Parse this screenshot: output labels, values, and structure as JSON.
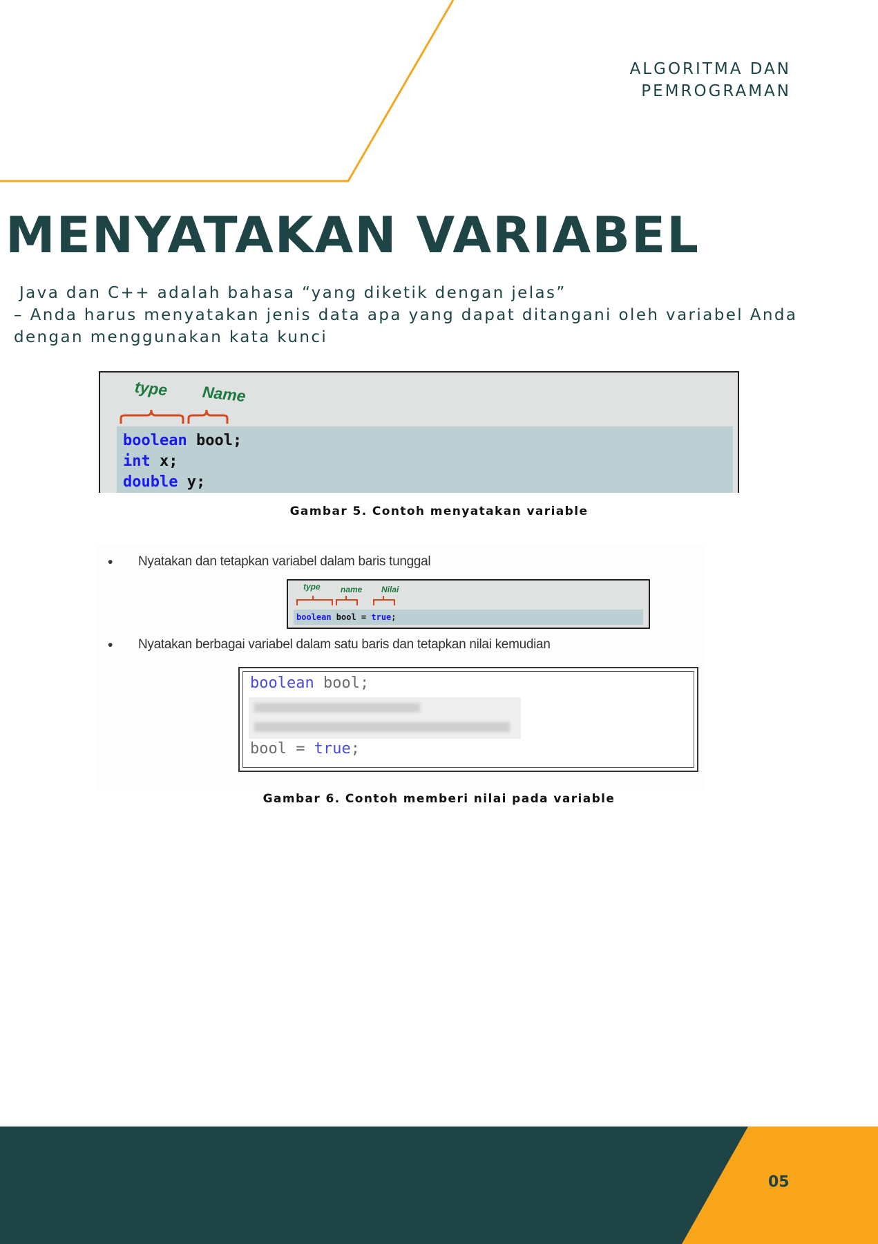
{
  "header": {
    "line1": "ALGORITMA DAN",
    "line2": "PEMROGRAMAN"
  },
  "title": "MENYATAKAN VARIABEL",
  "intro": {
    "line1": "Java dan C++ adalah bahasa “yang diketik dengan jelas”",
    "line2": "– Anda harus menyatakan jenis data apa yang dapat ditangani oleh variabel Anda",
    "line3": "dengan menggunakan kata kunci"
  },
  "figure5": {
    "annotation_type": "type",
    "annotation_name": "Name",
    "code": [
      {
        "keyword": "boolean",
        "rest": " bool;"
      },
      {
        "keyword": "int",
        "rest": " x;"
      },
      {
        "keyword": "double",
        "rest": " y;"
      }
    ],
    "caption": "Gambar 5. Contoh menyatakan variable"
  },
  "figure6": {
    "bullet_symbol": "•",
    "bullet1": "Nyatakan dan tetapkan variabel dalam baris tunggal",
    "mini_annotations": {
      "type": "type",
      "name": "name",
      "value": "Nilai"
    },
    "mini_code": {
      "keyword": "boolean",
      "middle": " bool = ",
      "value": "true",
      "end": ";"
    },
    "bullet2": "Nyatakan berbagai variabel dalam satu baris dan tetapkan nilai kemudian",
    "code_line1": {
      "keyword": "boolean",
      "rest": " bool;"
    },
    "code_line4": {
      "start": "bool = ",
      "value": "true",
      "end": ";"
    },
    "caption": "Gambar 6. Contoh memberi nilai pada variable"
  },
  "page_number": "05",
  "colors": {
    "accent": "#f9a51a",
    "dark": "#1e4446",
    "keyword": "#1a1aee",
    "annotation": "#1d7a3f"
  }
}
